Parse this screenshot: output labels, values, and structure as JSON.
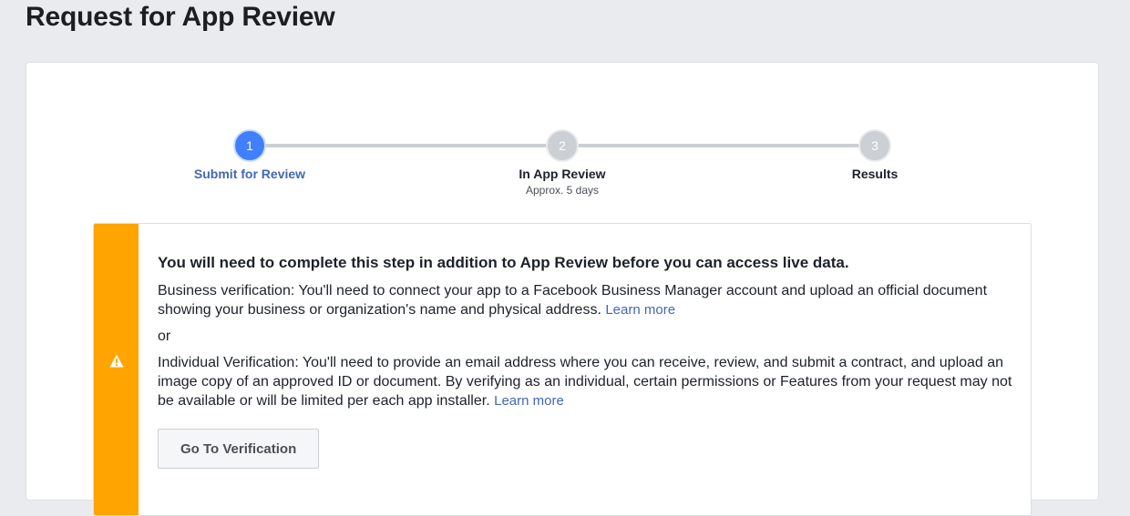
{
  "page": {
    "title": "Request for App Review"
  },
  "stepper": {
    "steps": [
      {
        "number": "1",
        "label": "Submit for Review",
        "sub": "",
        "active": true
      },
      {
        "number": "2",
        "label": "In App Review",
        "sub": "Approx. 5 days",
        "active": false
      },
      {
        "number": "3",
        "label": "Results",
        "sub": "",
        "active": false
      }
    ]
  },
  "notice": {
    "icon": "warning-icon",
    "heading": "You will need to complete this step in addition to App Review before you can access live data.",
    "business_text": "Business verification: You'll need to connect your app to a Facebook Business Manager account and upload an official document showing your business or organization's name and physical address.",
    "business_link": "Learn more",
    "or_text": "or",
    "individual_text": "Individual Verification: You'll need to provide an email address where you can receive, review, and submit a contract, and upload an image copy of an approved ID or document. By verifying as an individual, certain permissions or Features from your request may not be available or will be limited per each app installer.",
    "individual_link": "Learn more",
    "button_label": "Go To Verification"
  },
  "colors": {
    "accent": "#4080ff",
    "warning": "#ffa400",
    "link": "#4267b2"
  }
}
